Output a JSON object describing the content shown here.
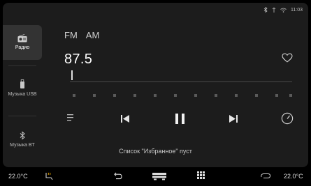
{
  "status": {
    "time": "11:03"
  },
  "sidebar": {
    "items": [
      {
        "label": "Радио",
        "icon": "radio-icon",
        "active": true
      },
      {
        "label": "Музыка USB",
        "icon": "usb-icon",
        "active": false
      },
      {
        "label": "Музыка BT",
        "icon": "bluetooth-icon",
        "active": false
      }
    ]
  },
  "bands": [
    "FM",
    "AM"
  ],
  "frequency": "87.5",
  "favorites_message": "Список \"Избранное\" пуст",
  "bottom_bar": {
    "temp_left": "22.0°C",
    "temp_right": "22.0°C"
  },
  "colors": {
    "panel": "#1c1c1c",
    "accent": "#ffffff",
    "muted": "#5a5a5a"
  }
}
